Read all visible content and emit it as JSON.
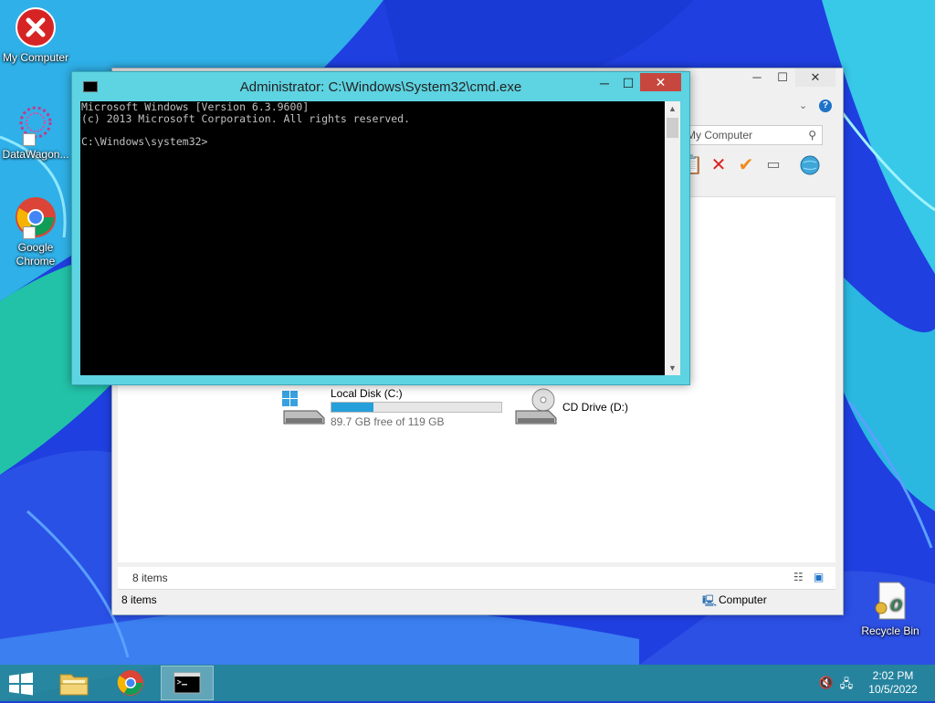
{
  "desktop": {
    "icons": [
      {
        "label": "My Computer",
        "icon": "error-x-icon"
      },
      {
        "label": "DataWagon...",
        "icon": "datawagon-icon"
      },
      {
        "label": "Google Chrome",
        "icon": "chrome-icon"
      },
      {
        "label": "Recycle Bin",
        "icon": "certificate-icon"
      }
    ]
  },
  "explorer": {
    "address_tail": "My Computer",
    "search_placeholder": "My Computer",
    "drives": [
      {
        "name": "Local Disk (C:)",
        "free_text": "89.7 GB free of 119 GB",
        "used_fraction": 0.246
      },
      {
        "name": "CD Drive (D:)"
      }
    ],
    "status_items": "8 items",
    "bottom_status_items": "8 items",
    "bottom_status_location": "Computer"
  },
  "cmd": {
    "title": "Administrator: C:\\Windows\\System32\\cmd.exe",
    "lines": [
      "Microsoft Windows [Version 6.3.9600]",
      "(c) 2013 Microsoft Corporation. All rights reserved.",
      "",
      "C:\\Windows\\system32>"
    ],
    "minimize_glyph": "─",
    "maximize_glyph": "☐",
    "close_glyph": "✕"
  },
  "taskbar": {
    "apps": [
      {
        "name": "file-explorer",
        "icon": "folder-icon"
      },
      {
        "name": "chrome",
        "icon": "chrome-icon"
      },
      {
        "name": "cmd",
        "icon": "terminal-icon",
        "active": true
      }
    ],
    "time": "2:02 PM",
    "date": "10/5/2022"
  },
  "colors": {
    "cmd_frame": "#5ed3e1",
    "cmd_close": "#c7473e",
    "taskbar": "#2a968c",
    "drive_bar_fill": "#26a0da"
  }
}
